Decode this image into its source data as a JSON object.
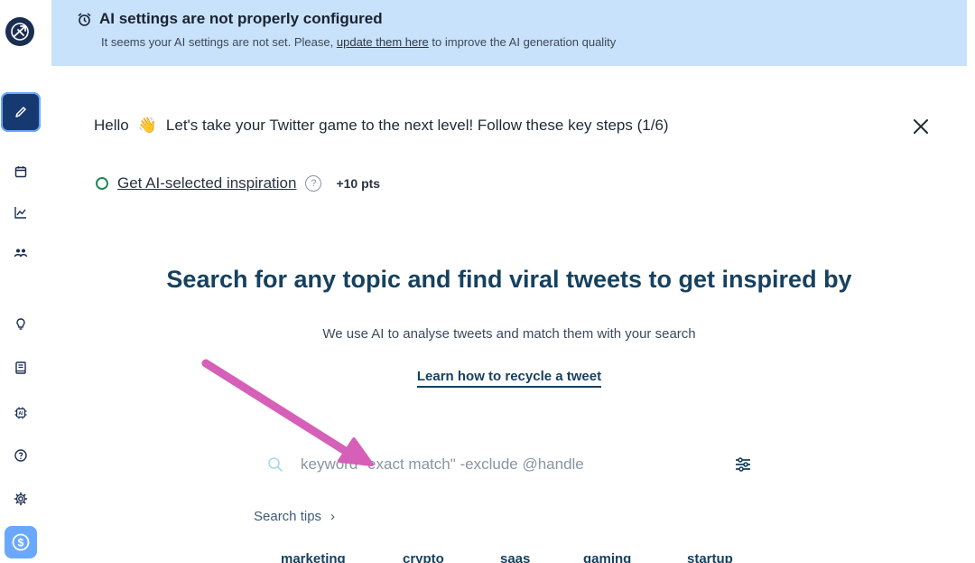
{
  "sidebar": {
    "logo_icon": "cannon-logo-icon",
    "items": [
      {
        "name": "compose",
        "icon": "pencil-icon"
      },
      {
        "name": "calendar",
        "icon": "calendar-icon"
      },
      {
        "name": "analytics",
        "icon": "chart-line-icon"
      },
      {
        "name": "audience",
        "icon": "users-icon"
      },
      {
        "name": "inspiration",
        "icon": "lightbulb-icon"
      },
      {
        "name": "library",
        "icon": "book-icon"
      },
      {
        "name": "ai",
        "icon": "ai-chip-icon"
      },
      {
        "name": "help",
        "icon": "question-icon"
      },
      {
        "name": "settings",
        "icon": "gear-icon"
      },
      {
        "name": "billing",
        "icon": "dollar-icon"
      }
    ]
  },
  "banner": {
    "title": "AI settings are not properly configured",
    "text_before": "It seems your AI settings are not set. Please,",
    "link": "update them here",
    "text_after": "to improve the AI generation quality"
  },
  "onboarding": {
    "hello": "Hello",
    "emoji": "👋",
    "message": "Let's take your Twitter game to the next level! Follow these key steps (1/6)",
    "step_label": "Get AI-selected inspiration",
    "step_points": "+10 pts"
  },
  "main": {
    "headline": "Search for any topic and find viral tweets to get inspired by",
    "subline": "We use AI to analyse tweets and match them with your search",
    "learn_link": "Learn how to recycle a tweet"
  },
  "search": {
    "placeholder": "keyword \"exact match\" -exclude @handle"
  },
  "tips": {
    "label": "Search tips",
    "chevron": "›"
  },
  "chips": [
    "marketing",
    "crypto",
    "saas",
    "gaming",
    "startup"
  ],
  "colors": {
    "banner_bg": "#c9e2fb",
    "accent": "#17415f",
    "arrow": "#d65fb8"
  }
}
